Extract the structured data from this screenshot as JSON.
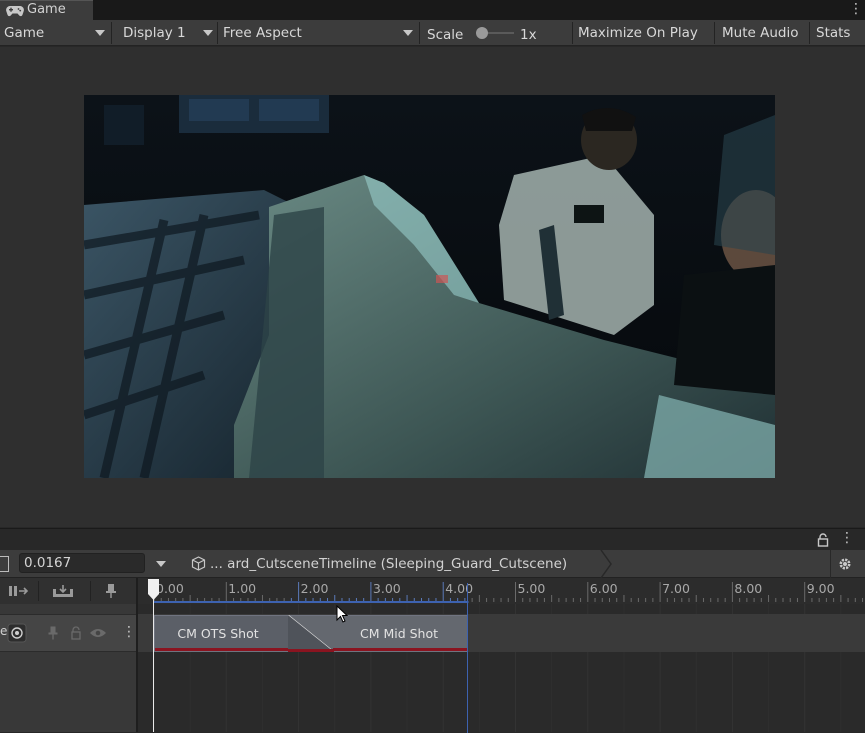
{
  "tab": {
    "title": "Game",
    "menu_glyph": "⋮"
  },
  "toolbar": {
    "mode": "Game",
    "display": "Display 1",
    "aspect": "Free Aspect",
    "scale_label": "Scale",
    "scale_value": "1x",
    "maximize": "Maximize On Play",
    "mute": "Mute Audio",
    "stats": "Stats"
  },
  "timeline": {
    "menu_glyph": "⋮",
    "time_value": "0.0167",
    "breadcrumb": "... ard_CutsceneTimeline (Sleeping_Guard_Cutscene)",
    "ruler_ticks": [
      "0.00",
      "1.00",
      "2.00",
      "3.00",
      "4.00",
      "5.00",
      "6.00",
      "7.00",
      "8.00",
      "9.00"
    ],
    "track_label_fragment": "e",
    "clips": [
      {
        "name": "CM OTS Shot"
      },
      {
        "name": "CM Mid Shot"
      }
    ],
    "colors": {
      "clip": "#5b5f67",
      "clip_underline": "#8b1420",
      "end_marker": "#3d62b0"
    }
  }
}
